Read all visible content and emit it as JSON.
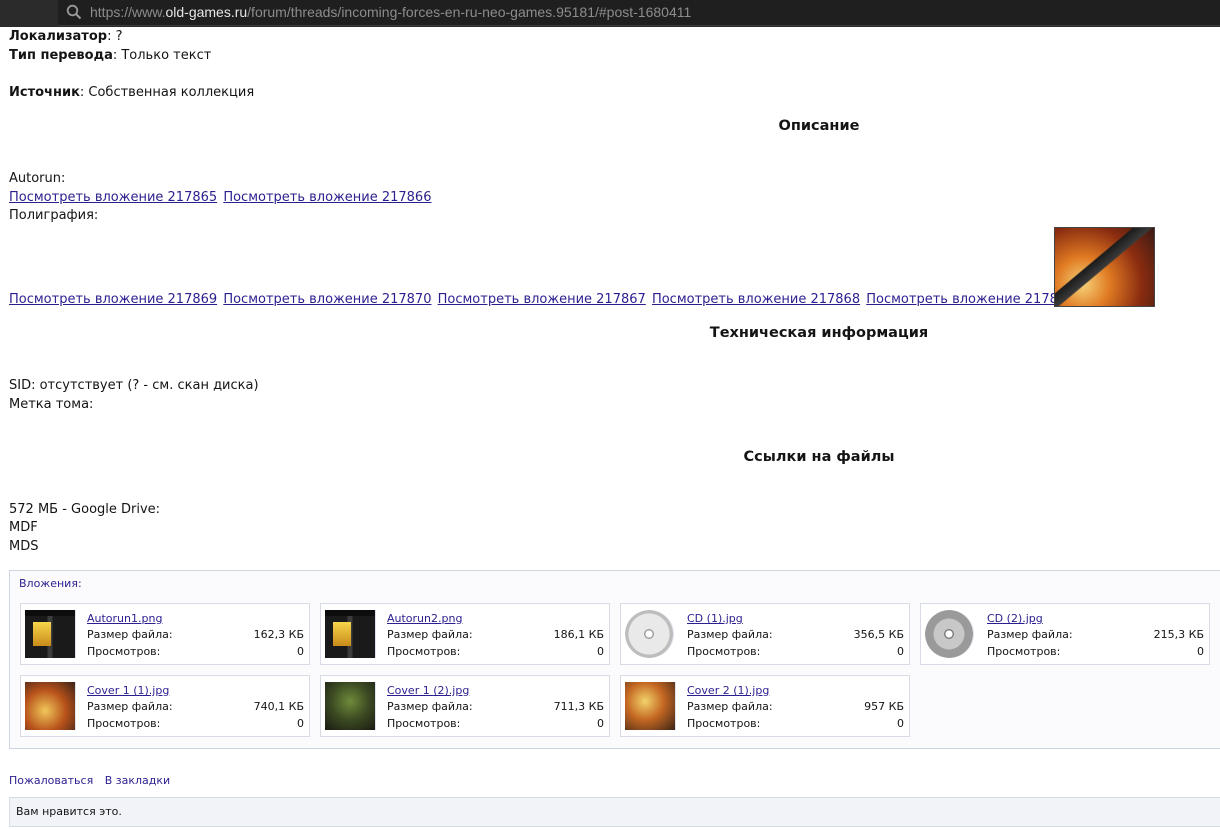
{
  "browser": {
    "url_prefix": "https://www.",
    "url_domain": "old-games.ru",
    "url_path": "/forum/threads/incoming-forces-en-ru-neo-games.95181/#post-1680411"
  },
  "post": {
    "localizer_label": "Локализатор",
    "localizer_value": ": ?",
    "translation_label": "Тип перевода",
    "translation_value": ": Только текст",
    "source_label": "Источник",
    "source_value": ": Собственная коллекция",
    "heading_description": "Описание",
    "autorun_label": "Autorun:",
    "autorun_links": [
      "Посмотреть вложение 217865",
      "Посмотреть вложение 217866"
    ],
    "polygraphy_label": "Полиграфия:",
    "polygraphy_links": [
      "Посмотреть вложение 217869",
      "Посмотреть вложение 217870",
      "Посмотреть вложение 217867",
      "Посмотреть вложение 217868",
      "Посмотреть вложение 217871"
    ],
    "heading_tech": "Техническая информация",
    "sid_line": "SID: отсутствует (? - см. скан диска)",
    "volume_label_line": "Метка тома:",
    "heading_links": "Ссылки на файлы",
    "size_line": "572 МБ - Google Drive:",
    "file_mdf": "MDF",
    "file_mds": "MDS"
  },
  "attachments": {
    "title": "Вложения:",
    "size_label": "Размер файла:",
    "views_label": "Просмотров:",
    "items": [
      {
        "name": "Autorun1.png",
        "size": "162,3 КБ",
        "views": "0",
        "thumb": "autorun"
      },
      {
        "name": "Autorun2.png",
        "size": "186,1 КБ",
        "views": "0",
        "thumb": "autorun"
      },
      {
        "name": "CD (1).jpg",
        "size": "356,5 КБ",
        "views": "0",
        "thumb": "cd"
      },
      {
        "name": "CD (2).jpg",
        "size": "215,3 КБ",
        "views": "0",
        "thumb": "cd"
      },
      {
        "name": "Cover 1 (1).jpg",
        "size": "740,1 КБ",
        "views": "0",
        "thumb": "cover"
      },
      {
        "name": "Cover 1 (2).jpg",
        "size": "711,3 КБ",
        "views": "0",
        "thumb": "cover"
      },
      {
        "name": "Cover 2 (1).jpg",
        "size": "957 КБ",
        "views": "0",
        "thumb": "cover"
      }
    ]
  },
  "actions": {
    "report": "Пожаловаться",
    "bookmark": "В закладки"
  },
  "likes": {
    "text": "Вам нравится это."
  },
  "colors": {
    "link": "#2a1f8f",
    "urlbar_bg": "#2b2b2b"
  }
}
